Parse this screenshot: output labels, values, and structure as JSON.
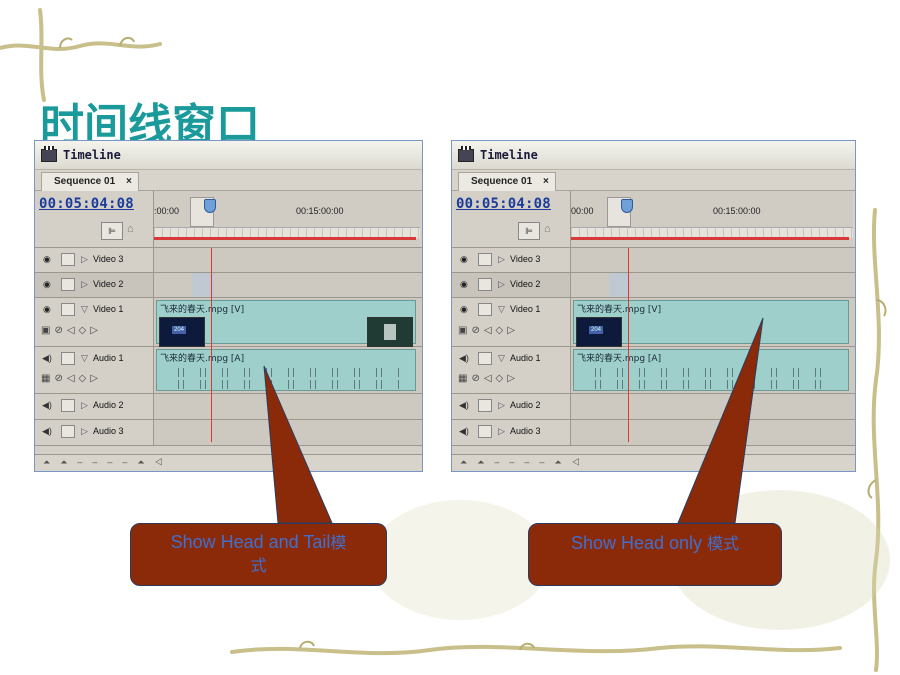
{
  "slide": {
    "title": "时间线窗口"
  },
  "panels": [
    {
      "window_title": "Timeline",
      "sequence_tab": "Sequence 01",
      "tab_close": "×",
      "timecode": "00:05:04:08",
      "ruler_start": ":00:00",
      "ruler_mid": "00:15:00:00",
      "tracks": {
        "video3": "Video 3",
        "video2": "Video 2",
        "video1": "Video 1",
        "audio1": "Audio 1",
        "audio2": "Audio 2",
        "audio3": "Audio 3"
      },
      "video_clip": "飞来的春天.mpg [V]",
      "audio_clip": "飞来的春天.mpg [A]",
      "thumb_badge": "204",
      "display_mode": "head-and-tail"
    },
    {
      "window_title": "Timeline",
      "sequence_tab": "Sequence 01",
      "tab_close": "×",
      "timecode": "00:05:04:08",
      "ruler_start": "00:00",
      "ruler_mid": "00:15:00:00",
      "tracks": {
        "video3": "Video 3",
        "video2": "Video 2",
        "video1": "Video 1",
        "audio1": "Audio 1",
        "audio2": "Audio 2",
        "audio3": "Audio 3"
      },
      "video_clip": "飞来的春天.mpg [V]",
      "audio_clip": "飞来的春天.mpg [A]",
      "thumb_badge": "204",
      "display_mode": "head-only"
    }
  ],
  "callouts": {
    "head_tail_latin": "Show Head and Tail",
    "head_tail_cjk_a": "模",
    "head_tail_cjk_b": "式",
    "head_only_latin": "Show Head only ",
    "head_only_cjk": "模式"
  },
  "colors": {
    "title": "#1a9a9a",
    "callout_fill": "#8b2a08",
    "callout_text": "#3f6fd0",
    "clip": "#9ecfcb",
    "playhead": "#e23a2a",
    "timecode": "#1b3c9a"
  },
  "icons": {
    "window": "timeline-window-icon",
    "eye": "eye-icon",
    "speaker": "speaker-icon",
    "expand": "triangle-expand-icon",
    "collapse": "triangle-collapse-icon"
  }
}
